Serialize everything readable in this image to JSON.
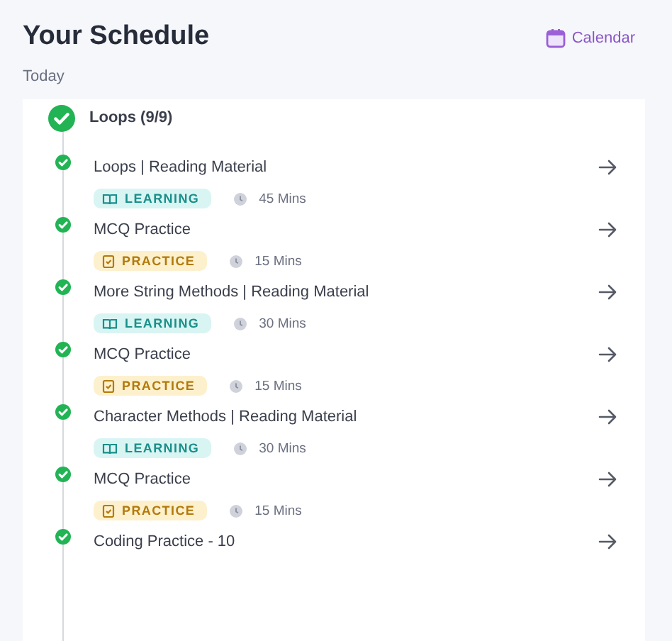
{
  "header": {
    "title": "Your Schedule",
    "calendar_link": "Calendar"
  },
  "day_label": "Today",
  "group": {
    "title": "Loops (9/9)",
    "completed": true,
    "items": [
      {
        "title": "Loops | Reading Material",
        "completed": true,
        "kind": "learning",
        "tag": "LEARNING",
        "duration": "45 Mins"
      },
      {
        "title": "MCQ Practice",
        "completed": true,
        "kind": "practice",
        "tag": "PRACTICE",
        "duration": "15 Mins"
      },
      {
        "title": "More String Methods | Reading Material",
        "completed": true,
        "kind": "learning",
        "tag": "LEARNING",
        "duration": "30 Mins"
      },
      {
        "title": "MCQ Practice",
        "completed": true,
        "kind": "practice",
        "tag": "PRACTICE",
        "duration": "15 Mins"
      },
      {
        "title": "Character Methods | Reading Material",
        "completed": true,
        "kind": "learning",
        "tag": "LEARNING",
        "duration": "30 Mins"
      },
      {
        "title": "MCQ Practice",
        "completed": true,
        "kind": "practice",
        "tag": "PRACTICE",
        "duration": "15 Mins"
      },
      {
        "title": "Coding Practice - 10",
        "completed": true
      }
    ]
  }
}
